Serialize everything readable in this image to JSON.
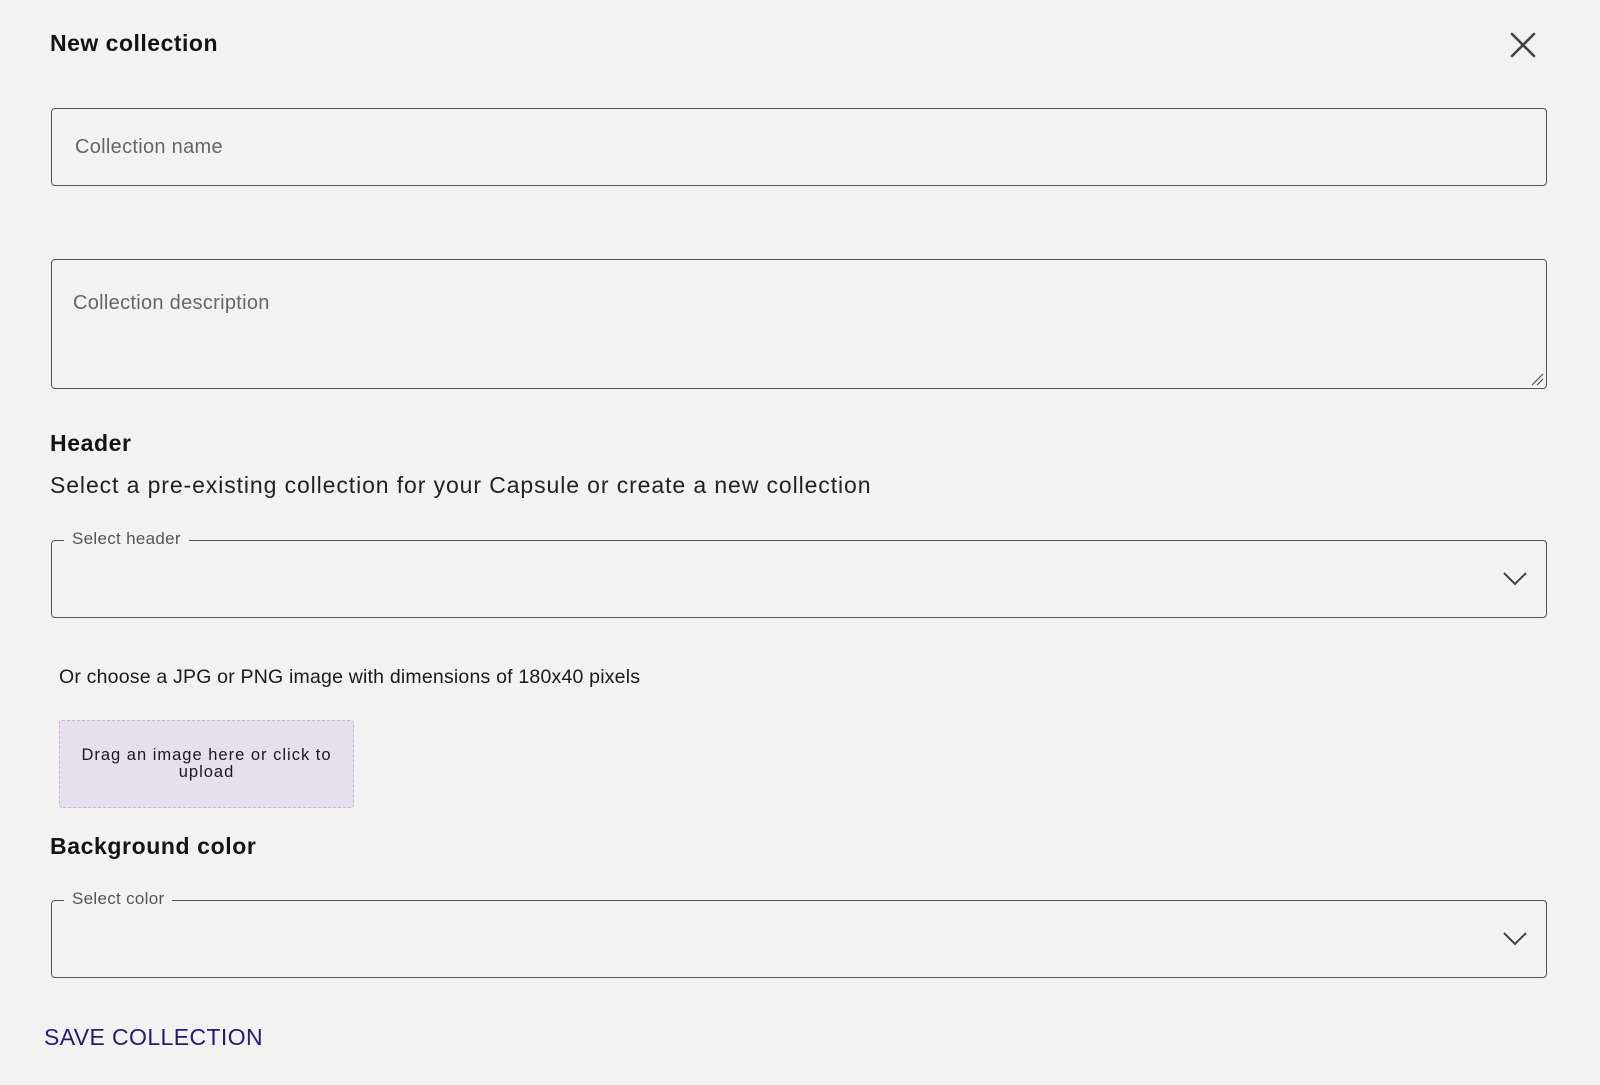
{
  "dialog": {
    "title": "New collection",
    "close_icon": "close-icon"
  },
  "form": {
    "name_placeholder": "Collection name",
    "name_value": "",
    "description_placeholder": "Collection description",
    "description_value": ""
  },
  "header_section": {
    "heading": "Header",
    "subtitle": "Select a pre-existing collection for your Capsule or create a new collection",
    "select_label": "Select header",
    "select_value": "",
    "hint": "Or choose a JPG or PNG image with dimensions of 180x40 pixels",
    "dropzone_text": "Drag an image here or click to upload"
  },
  "background_section": {
    "heading": "Background color",
    "select_label": "Select color",
    "select_value": ""
  },
  "actions": {
    "save_label": "SAVE COLLECTION"
  },
  "colors": {
    "background": "#f2f2f2",
    "border": "#555555",
    "dropzone_bg": "#e6dfed",
    "accent": "#2a1a6e"
  }
}
